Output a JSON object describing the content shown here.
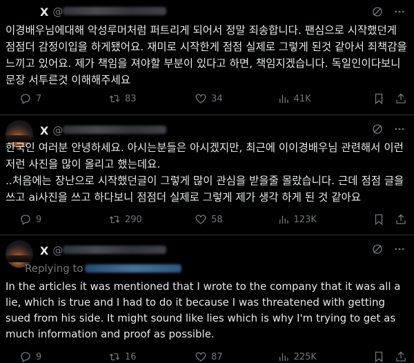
{
  "tweets": [
    {
      "name": "X",
      "handle_prefix": "@",
      "text": [
        "이경배우님에대해 악성루머처럼 퍼트리게 되어서 정말 죄송합니다. 팬심으로 시작했던게 점점더 감정이입을 하게됐어요. 재미로 시작한게 점점 실제로 그렇게 된것 같아서 죄책감을 느끼고 있어요. 제가 책임을 져야할 부분이 있다고 하면, 책임지겠습니다. 독일인이다보니 문장 서투른것 이해해주세요"
      ],
      "replies": "7",
      "reposts": "83",
      "likes": "34",
      "views": "41K"
    },
    {
      "name": "X",
      "handle_prefix": "@",
      "text": [
        "한국인 여러분 안녕하세요. 아시는분들은 아시겠지만, 최근에 이이경배우님 관련해서 이런저런 사진을 많이 올리고 했는데요.",
        "..처음에는 장난으로 시작했던글이 그렇게 많이 관심을 받을줄 몰랐습니다. 근데 점점 글을쓰고 ai사진을 쓰고 하다보니 점점더 실제로 그렇게 제가 생각 하게 된 것 같아요"
      ],
      "replies": "9",
      "reposts": "290",
      "likes": "58",
      "views": "123K"
    },
    {
      "name": "X",
      "handle_prefix": "@",
      "replying_label": "Replying to",
      "text": [
        "In the articles it was mentioned that I wrote to the company that it was all a lie, which is true and I had to do it because I was threatened with getting sued from his side. It might sound like lies which is why I'm trying to get as much information and proof as possible."
      ],
      "replies": "9",
      "reposts": "16",
      "likes": "87",
      "views": "225K"
    }
  ],
  "icons": [
    "grok-icon",
    "more-icon",
    "reply-icon",
    "repost-icon",
    "like-icon",
    "views-icon",
    "bookmark-icon",
    "share-icon"
  ],
  "colors": {
    "background": "#000000",
    "text": "#e7e9ea",
    "muted": "#71767b",
    "divider": "#2f3336"
  }
}
